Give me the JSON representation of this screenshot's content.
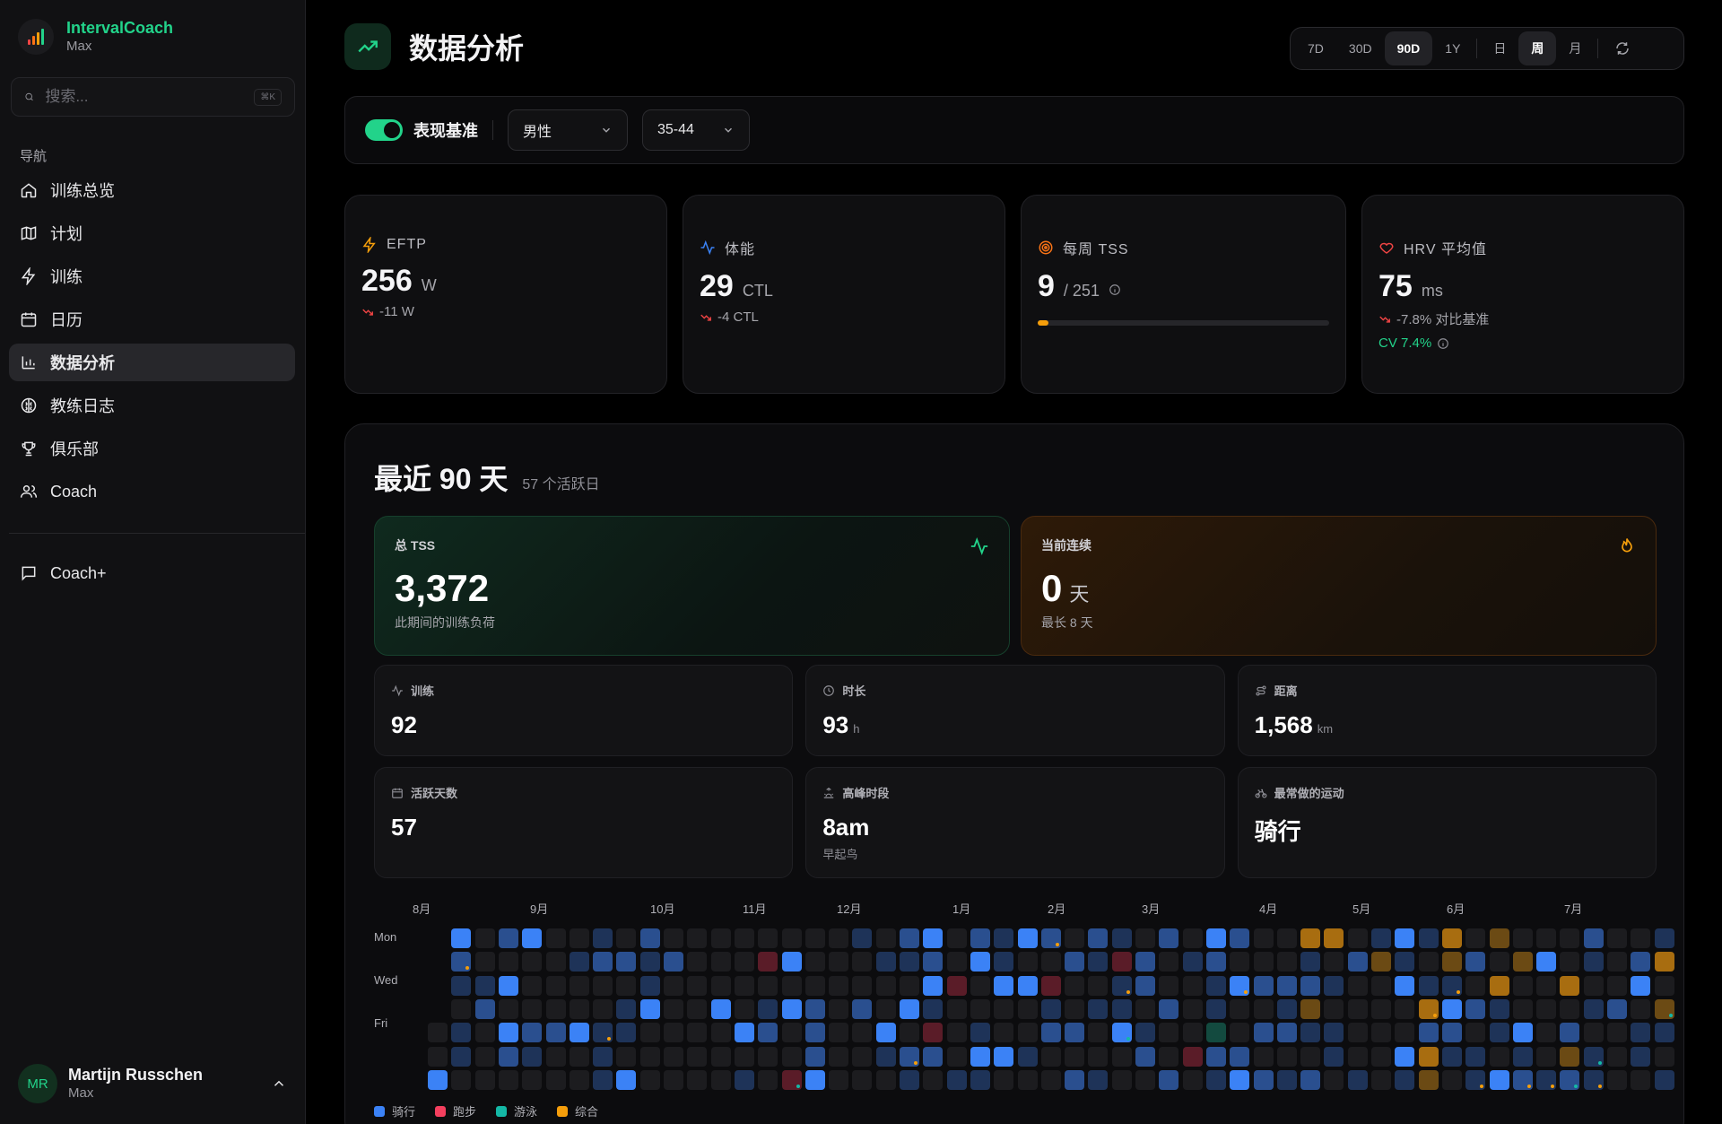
{
  "app": {
    "name": "IntervalCoach",
    "subtitle": "Max"
  },
  "search": {
    "placeholder": "搜索...",
    "shortcut": "⌘K"
  },
  "nav": {
    "label": "导航",
    "items": [
      {
        "label": "训练总览",
        "icon": "home-icon"
      },
      {
        "label": "计划",
        "icon": "map-icon"
      },
      {
        "label": "训练",
        "icon": "bolt-icon"
      },
      {
        "label": "日历",
        "icon": "calendar-icon"
      },
      {
        "label": "数据分析",
        "icon": "bar-chart-icon",
        "active": true
      },
      {
        "label": "教练日志",
        "icon": "brain-icon"
      },
      {
        "label": "俱乐部",
        "icon": "trophy-icon"
      },
      {
        "label": "Coach",
        "icon": "users-icon"
      }
    ],
    "secondary": [
      {
        "label": "Coach+",
        "icon": "message-icon"
      }
    ]
  },
  "user": {
    "initials": "MR",
    "name": "Martijn Russchen",
    "subtitle": "Max"
  },
  "page": {
    "title": "数据分析"
  },
  "range": {
    "options": [
      "7D",
      "30D",
      "90D",
      "1Y"
    ],
    "selected": "90D",
    "granularity": [
      "日",
      "周",
      "月"
    ],
    "granularity_selected": "周"
  },
  "filters": {
    "benchmark_label": "表现基准",
    "benchmark_on": true,
    "gender": "男性",
    "age": "35-44"
  },
  "metrics": {
    "eftp": {
      "label": "EFTP",
      "value": "256",
      "unit": "W",
      "delta": "-11 W"
    },
    "fitness": {
      "label": "体能",
      "value": "29",
      "unit": "CTL",
      "delta": "-4 CTL"
    },
    "weekly_tss": {
      "label": "每周 TSS",
      "value": "9",
      "target": "/ 251",
      "progress": 0.036
    },
    "hrv": {
      "label": "HRV 平均值",
      "value": "75",
      "unit": "ms",
      "delta": "-7.8% 对比基准",
      "cv": "CV 7.4%"
    }
  },
  "summary": {
    "title": "最近 90 天",
    "subtitle": "57 个活跃日",
    "total_tss": {
      "label": "总 TSS",
      "value": "3,372",
      "sub": "此期间的训练负荷"
    },
    "streak": {
      "label": "当前连续",
      "value": "0",
      "unit": "天",
      "sub": "最长 8 天"
    },
    "workouts": {
      "label": "训练",
      "value": "92"
    },
    "duration": {
      "label": "时长",
      "value": "93",
      "unit": "h"
    },
    "distance": {
      "label": "距离",
      "value": "1,568",
      "unit": "km"
    },
    "active_days": {
      "label": "活跃天数",
      "value": "57"
    },
    "peak_time": {
      "label": "高峰时段",
      "value": "8am",
      "sub": "早起鸟"
    },
    "top_sport": {
      "label": "最常做的运动",
      "value": "骑行"
    }
  },
  "heatmap": {
    "months": [
      "8月",
      "9月",
      "10月",
      "11月",
      "12月",
      "1月",
      "2月",
      "3月",
      "4月",
      "5月",
      "6月",
      "7月"
    ],
    "day_labels": [
      "Mon",
      "Wed",
      "Fri"
    ],
    "legend": [
      {
        "label": "骑行",
        "color": "#3b82f6"
      },
      {
        "label": "跑步",
        "color": "#f43f5e"
      },
      {
        "label": "游泳",
        "color": "#14b8a6"
      },
      {
        "label": "综合",
        "color": "#f59e0b"
      }
    ],
    "colors": {
      "empty": "#1c1c1f",
      "c1": "#1e3358",
      "c2": "#2a4f8f",
      "c3": "#3b82f6",
      "r": "#5a1c28",
      "s": "#134a3f",
      "m": "#6b4a14",
      "m2": "#a86d10"
    }
  }
}
